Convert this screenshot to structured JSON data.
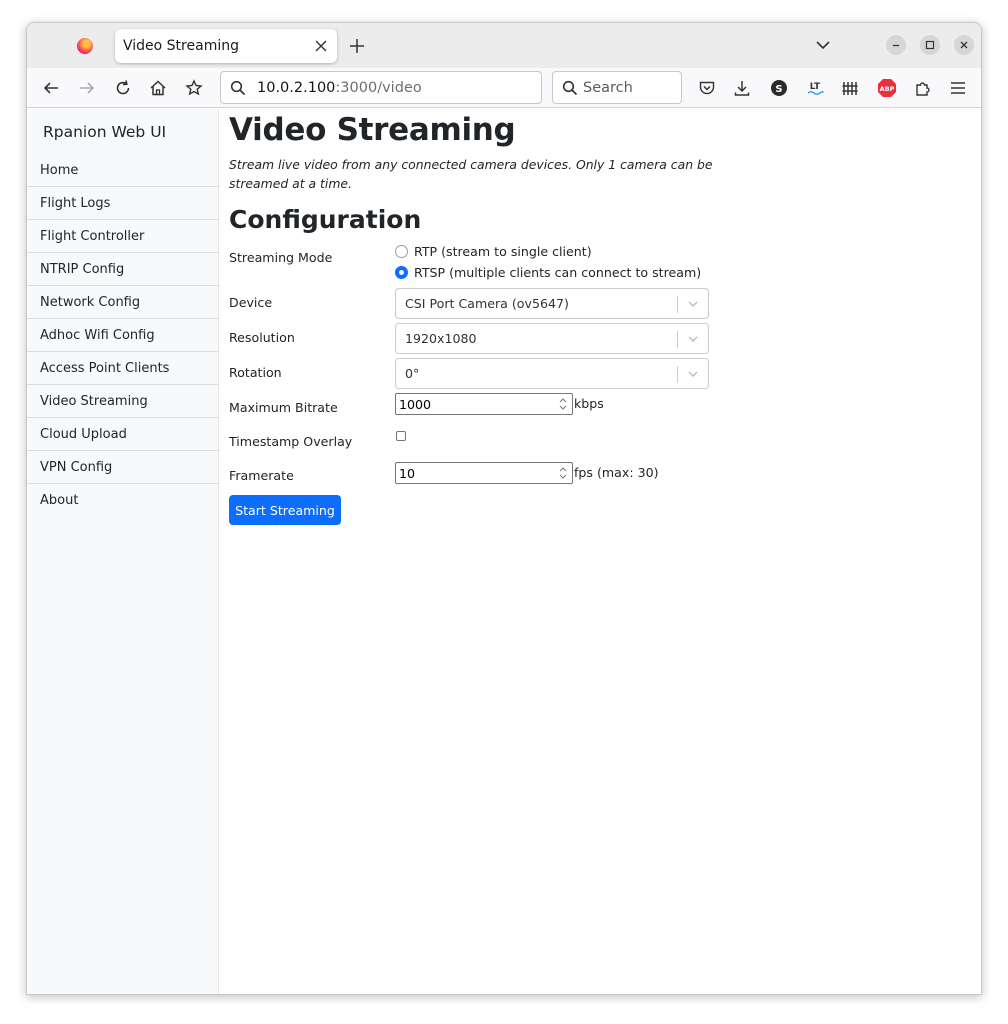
{
  "browser": {
    "tab_title": "Video Streaming",
    "url_host": "10.0.2.100",
    "url_path": ":3000/video",
    "search_placeholder": "Search"
  },
  "sidebar": {
    "brand": "Rpanion Web UI",
    "items": [
      {
        "label": "Home"
      },
      {
        "label": "Flight Logs"
      },
      {
        "label": "Flight Controller"
      },
      {
        "label": "NTRIP Config"
      },
      {
        "label": "Network Config"
      },
      {
        "label": "Adhoc Wifi Config"
      },
      {
        "label": "Access Point Clients"
      },
      {
        "label": "Video Streaming"
      },
      {
        "label": "Cloud Upload"
      },
      {
        "label": "VPN Config"
      },
      {
        "label": "About"
      }
    ]
  },
  "main": {
    "title": "Video Streaming",
    "lead": "Stream live video from any connected camera devices. Only 1 camera can be streamed at a time.",
    "section_title": "Configuration",
    "streaming_mode": {
      "label": "Streaming Mode",
      "options": [
        {
          "label": "RTP (stream to single client)",
          "checked": false
        },
        {
          "label": "RTSP (multiple clients can connect to stream)",
          "checked": true
        }
      ]
    },
    "device": {
      "label": "Device",
      "value": "CSI Port Camera (ov5647)"
    },
    "resolution": {
      "label": "Resolution",
      "value": "1920x1080"
    },
    "rotation": {
      "label": "Rotation",
      "value": "0°"
    },
    "bitrate": {
      "label": "Maximum Bitrate",
      "value": "1000",
      "unit": "kbps"
    },
    "timestamp": {
      "label": "Timestamp Overlay",
      "checked": false
    },
    "framerate": {
      "label": "Framerate",
      "value": "10",
      "unit": "fps (max: 30)"
    },
    "start_button": "Start Streaming"
  },
  "colors": {
    "accent": "#0d6efd",
    "sidebar_bg": "#f8f9fa"
  }
}
